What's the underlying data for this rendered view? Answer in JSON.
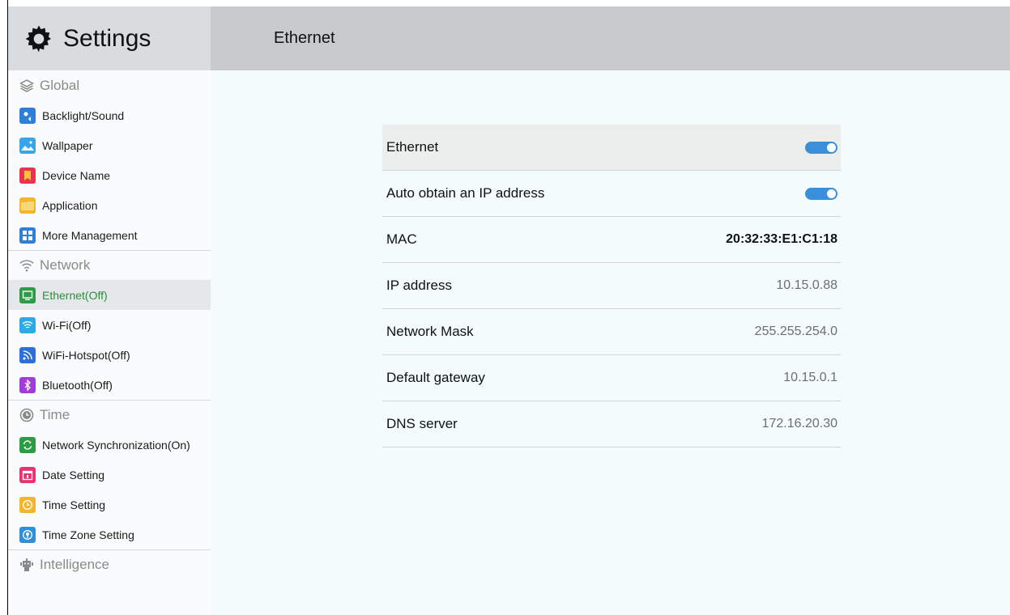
{
  "app": {
    "title": "Settings"
  },
  "page": {
    "title": "Ethernet"
  },
  "sidebar": {
    "sections": [
      {
        "label": "Global",
        "items": [
          {
            "label": "Backlight/Sound",
            "icon": "backlight-sound-icon",
            "color": "#2f7fd8"
          },
          {
            "label": "Wallpaper",
            "icon": "wallpaper-icon",
            "color": "#39a5e8"
          },
          {
            "label": "Device Name",
            "icon": "device-name-icon",
            "color": "#e8344e"
          },
          {
            "label": "Application",
            "icon": "application-icon",
            "color": "#f3b52b"
          },
          {
            "label": "More Management",
            "icon": "more-management-icon",
            "color": "#2f7fd8"
          }
        ]
      },
      {
        "label": "Network",
        "items": [
          {
            "label": "Ethernet(Off)",
            "icon": "ethernet-icon",
            "color": "#2e9b45",
            "active": true
          },
          {
            "label": "Wi-Fi(Off)",
            "icon": "wifi-icon",
            "color": "#2ea9e6"
          },
          {
            "label": "WiFi-Hotspot(Off)",
            "icon": "wifi-hotspot-icon",
            "color": "#2f6fd8"
          },
          {
            "label": "Bluetooth(Off)",
            "icon": "bluetooth-icon",
            "color": "#a23cd8"
          }
        ]
      },
      {
        "label": "Time",
        "items": [
          {
            "label": "Network Synchronization(On)",
            "icon": "network-sync-icon",
            "color": "#2e9b45"
          },
          {
            "label": "Date Setting",
            "icon": "date-setting-icon",
            "color": "#e8346e"
          },
          {
            "label": "Time Setting",
            "icon": "time-setting-icon",
            "color": "#f3b52b"
          },
          {
            "label": "Time Zone Setting",
            "icon": "time-zone-icon",
            "color": "#2f8fd8"
          }
        ]
      },
      {
        "label": "Intelligence",
        "items": []
      }
    ]
  },
  "ethernet": {
    "enabled_label": "Ethernet",
    "enabled": true,
    "auto_ip_label": "Auto obtain an IP address",
    "auto_ip": true,
    "mac_label": "MAC",
    "mac_value": "20:32:33:E1:C1:18",
    "ip_label": "IP address",
    "ip_value": "10.15.0.88",
    "mask_label": "Network Mask",
    "mask_value": "255.255.254.0",
    "gateway_label": "Default gateway",
    "gateway_value": "10.15.0.1",
    "dns_label": "DNS server",
    "dns_value": "172.16.20.30"
  },
  "colors": {
    "accent": "#3b8fd8",
    "active_text": "#2e8b3e"
  }
}
